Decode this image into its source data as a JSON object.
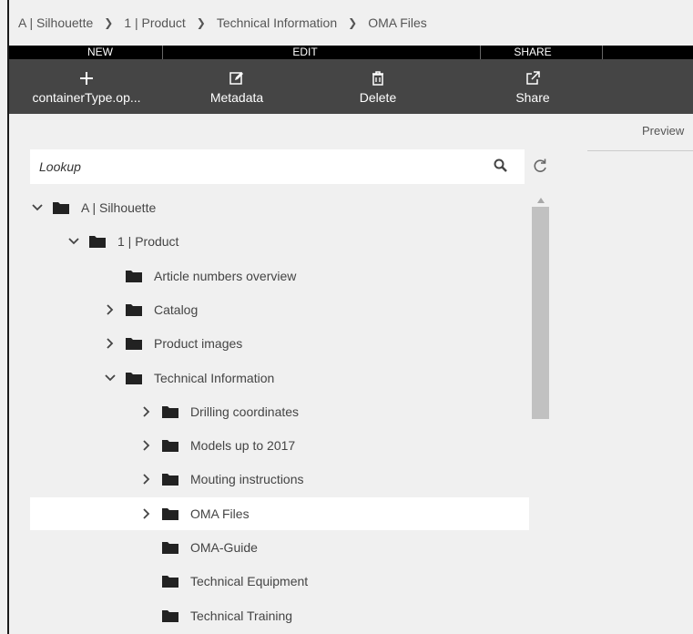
{
  "breadcrumb": [
    "A | Silhouette",
    "1 | Product",
    "Technical Information",
    "OMA Files"
  ],
  "toolbar": {
    "groups": [
      "NEW",
      "EDIT",
      "SHARE"
    ],
    "buttons": {
      "new": "containerType.op...",
      "metadata": "Metadata",
      "delete": "Delete",
      "share": "Share"
    }
  },
  "search": {
    "placeholder": "Lookup"
  },
  "preview": {
    "label": "Preview"
  },
  "tree": [
    {
      "label": "A | Silhouette",
      "level": 0,
      "expander": "expanded"
    },
    {
      "label": "1 | Product",
      "level": 1,
      "expander": "expanded"
    },
    {
      "label": "Article numbers overview",
      "level": 2,
      "expander": "none"
    },
    {
      "label": "Catalog",
      "level": 2,
      "expander": "collapsed"
    },
    {
      "label": "Product images",
      "level": 2,
      "expander": "collapsed"
    },
    {
      "label": "Technical Information",
      "level": 2,
      "expander": "expanded"
    },
    {
      "label": "Drilling coordinates",
      "level": 3,
      "expander": "collapsed"
    },
    {
      "label": "Models up to 2017",
      "level": 3,
      "expander": "collapsed"
    },
    {
      "label": "Mouting instructions",
      "level": 3,
      "expander": "collapsed"
    },
    {
      "label": "OMA Files",
      "level": 3,
      "expander": "collapsed",
      "selected": true
    },
    {
      "label": "OMA-Guide",
      "level": 3,
      "expander": "none"
    },
    {
      "label": "Technical Equipment",
      "level": 3,
      "expander": "none"
    },
    {
      "label": "Technical Training",
      "level": 3,
      "expander": "none"
    }
  ]
}
